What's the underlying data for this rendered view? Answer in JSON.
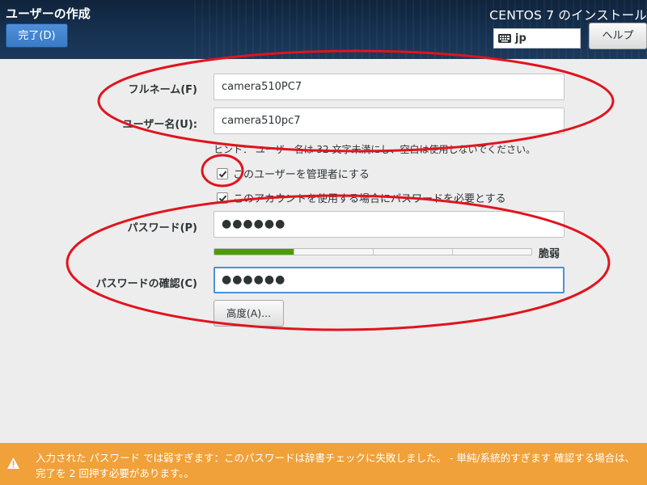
{
  "header": {
    "spoke_title": "ユーザーの作成",
    "done_button": "完了(D)",
    "product_title": "CENTOS 7 のインストール",
    "keyboard_layout": "jp",
    "help_button": "ヘルプ"
  },
  "form": {
    "fullname": {
      "label": "フルネーム(F)",
      "value": "camera510PC7"
    },
    "username": {
      "label": "ユーザー名(U):",
      "value": "camera510pc7"
    },
    "hint": "ヒント：  ユーザー名は  32  文字未満にし、空白は使用しないでください。",
    "admin_checkbox": {
      "label": "このユーザーを管理者にする",
      "checked": true
    },
    "require_password_checkbox": {
      "label": "このアカウントを使用する場合にパスワードを必要とする",
      "checked": true
    },
    "password": {
      "label": "パスワード(P)",
      "value": "●●●●●●"
    },
    "strength": {
      "label": "脆弱",
      "level": 0.25
    },
    "confirm": {
      "label": "パスワードの確認(C)",
      "value": "●●●●●●"
    },
    "advanced_button": "高度(A)..."
  },
  "warning": {
    "text": "入力された パスワード では弱すぎます：このパスワードは辞書チェックに失敗しました。 - 単純/系統的すぎます 確認する場合は、完了を 2 回押す必要があります。。"
  },
  "colors": {
    "header_bg": "#173252",
    "done_button": "#3a7bc8",
    "warning_bg": "#f0a13a",
    "strength_fill": "#4e9a06",
    "annotation": "#e0141e",
    "focus_border": "#4a90d9"
  }
}
